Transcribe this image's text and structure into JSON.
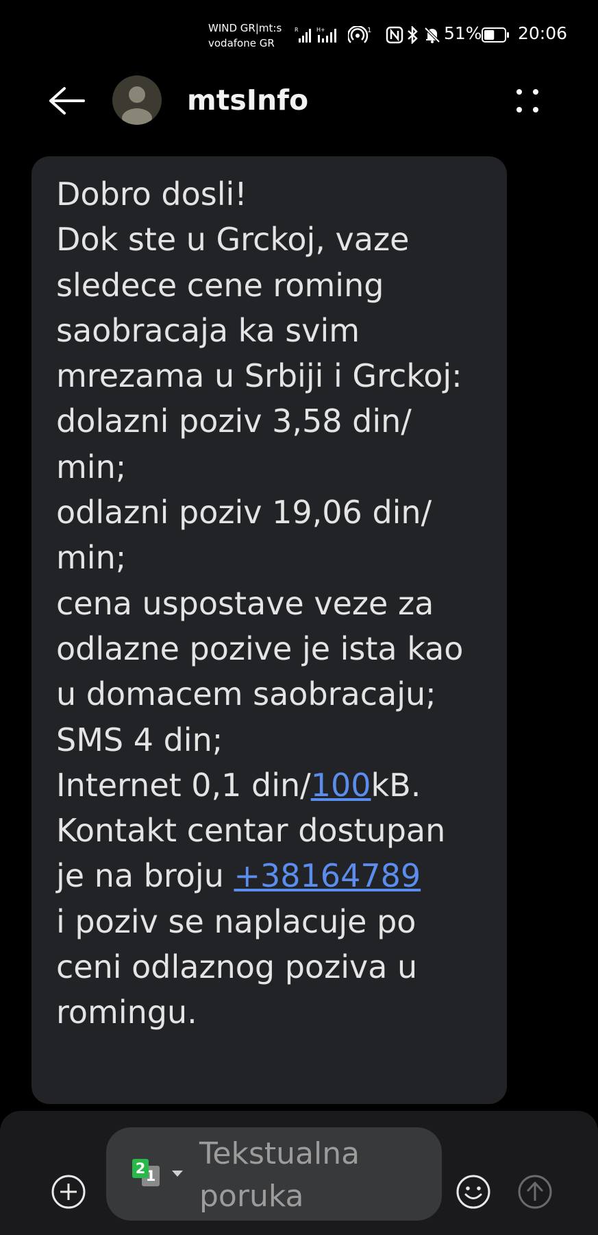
{
  "status_bar": {
    "carrier_1": "WIND GR|mt:s",
    "carrier_2": "vodafone GR",
    "signal_1_label": "R",
    "signal_2_label": "H+",
    "hotspot_superscript": "1",
    "battery_percent": "51%",
    "battery_level": 0.51,
    "time": "20:06"
  },
  "header": {
    "title": "mtsInfo",
    "back_icon": "arrow-left-icon",
    "more_icon": "more-options-icon"
  },
  "message": {
    "lines": [
      "Dobro dosli!",
      "Dok ste u Grckoj, vaze",
      "sledece cene roming",
      "saobracaja ka svim",
      "mrezama u Srbiji i Grckoj:",
      "dolazni poziv 3,58 din/",
      "min;",
      "odlazni poziv 19,06 din/",
      "min;",
      "cena uspostave veze za",
      "odlazne pozive je ista kao",
      "u domacem saobracaju;",
      "SMS 4 din;"
    ],
    "internet_prefix": "Internet 0,1 din/",
    "internet_link": "100",
    "internet_suffix": "kB.",
    "contact_line": "Kontakt centar dostupan",
    "phone_prefix": "je na broju ",
    "phone_link": "+38164789",
    "tail_lines": [
      "i poziv se naplacuje po",
      "ceni odlaznog poziva u",
      "romingu."
    ],
    "link_color": "#5a8dee"
  },
  "composer": {
    "sim_primary": "2",
    "sim_secondary": "1",
    "placeholder_line_1": "Tekstualna",
    "placeholder_line_2": "poruka",
    "add_icon": "plus-circle-icon",
    "emoji_icon": "emoji-icon",
    "send_icon": "send-icon"
  }
}
